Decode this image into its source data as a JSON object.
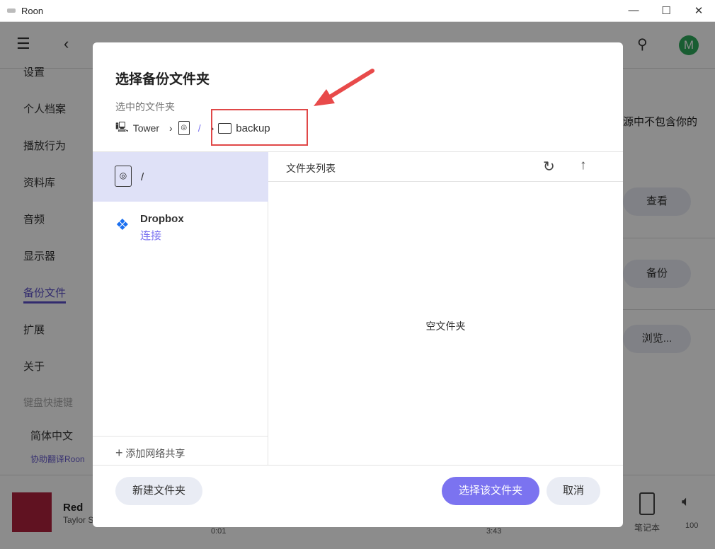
{
  "window": {
    "title": "Roon",
    "controls": [
      "—",
      "☐",
      "✕"
    ]
  },
  "topbar": {
    "avatar_letter": "M"
  },
  "sidebar": {
    "items": [
      "设置",
      "个人档案",
      "播放行为",
      "资料库",
      "音频",
      "显示器",
      "备份文件",
      "扩展",
      "关于",
      "键盘快捷键"
    ],
    "active": "备份文件",
    "language": "简体中文",
    "translate_link": "协助翻译Roon"
  },
  "content": {
    "partial_text": "源中不包含你的",
    "buttons": [
      "查看",
      "备份",
      "浏览..."
    ]
  },
  "player": {
    "track": "Red",
    "artist": "Taylor Swift",
    "elapsed": "0:01",
    "duration": "3:43",
    "zone": "笔记本",
    "volume": "100"
  },
  "dialog": {
    "title": "选择备份文件夹",
    "selected_label": "选中的文件夹",
    "breadcrumb": [
      "Tower",
      "/",
      "backup"
    ],
    "sources": [
      {
        "name": "/"
      },
      {
        "name": "Dropbox",
        "action": "连接"
      }
    ],
    "add_share": "添加网络共享",
    "list_header": "文件夹列表",
    "empty_text": "空文件夹",
    "new_folder": "新建文件夹",
    "select": "选择该文件夹",
    "cancel": "取消"
  },
  "colors": {
    "accent": "#7b73f0",
    "highlight_box": "#e04848",
    "avatar": "#2eaa5c"
  }
}
